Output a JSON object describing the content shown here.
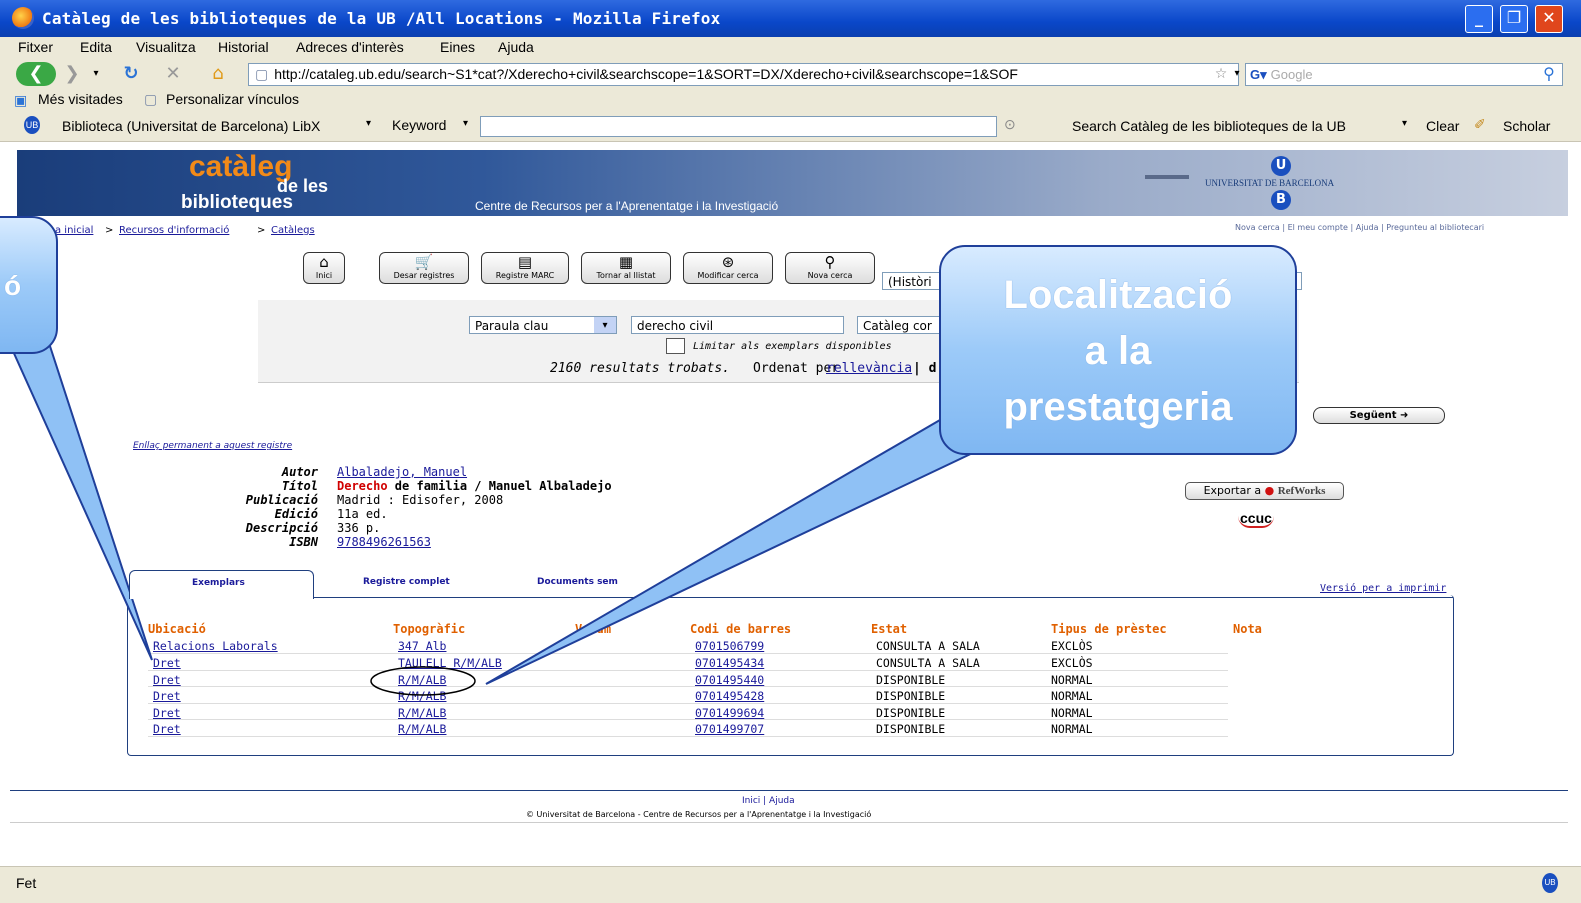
{
  "window": {
    "title": "Catàleg de les biblioteques de la UB /All Locations - Mozilla Firefox"
  },
  "menu": [
    "Fitxer",
    "Edita",
    "Visualitza",
    "Historial",
    "Adreces d'interès",
    "Eines",
    "Ajuda"
  ],
  "nav": {
    "url": "http://cataleg.ub.edu/search~S1*cat?/Xderecho+civil&searchscope=1&SORT=DX/Xderecho+civil&searchscope=1&SOF",
    "search_placeholder": "Google"
  },
  "bookmarks": [
    "Més visitades",
    "Personalizar vínculos"
  ],
  "libx": {
    "name": "Biblioteca (Universitat de Barcelona) LibX",
    "keyword": "Keyword",
    "search": "Search Catàleg de les biblioteques de la UB",
    "clear": "Clear",
    "scholar": "Scholar"
  },
  "banner": {
    "logo1": "catàleg",
    "logo2": "de les",
    "logo3": "biblioteques",
    "subtitle": "Centre de Recursos per a l'Aprenentatge i la Investigació",
    "university": "UNIVERSITAT DE BARCELONA"
  },
  "crumbs": {
    "home": "a inicial",
    "sep": ">",
    "res": "Recursos d'informació",
    "cat": "Catàlegs"
  },
  "toplinks": "Nova cerca | El meu compte | Ajuda | Pregunteu al bibliotecari",
  "tools": [
    "Inici",
    "Desar registres",
    "Registre MARC",
    "Tornar al llistat",
    "Modificar cerca",
    "Nova cerca"
  ],
  "tool_icons": [
    "home-icon",
    "cart-icon",
    "marc-icon",
    "list-icon",
    "modify-icon",
    "search-icon"
  ],
  "history_label": "(Històri",
  "search": {
    "type": "Paraula clau",
    "term": "derecho civil",
    "catalog": "Catàleg cor",
    "limit_label": "Limitar als exemplars disponibles",
    "results": "2160 resultats trobats.",
    "sorted": "Ordenat per",
    "relevance": "rellevància",
    "sep": "| d"
  },
  "next_label": "Següent",
  "permalink": "Enllaç permanent a aquest registre",
  "record": {
    "fields": [
      {
        "label": "Autor",
        "value": "Albaladejo, Manuel",
        "link": true
      },
      {
        "label": "Títol",
        "value_hl": "Derecho",
        "value": " de familia / Manuel Albaladejo"
      },
      {
        "label": "Publicació",
        "value": "Madrid : Edisofer, 2008"
      },
      {
        "label": "Edició",
        "value": "11a ed."
      },
      {
        "label": "Descripció",
        "value": "336 p."
      },
      {
        "label": "ISBN",
        "value": "9788496261563",
        "link": true
      }
    ]
  },
  "export": {
    "label": "Exportar a",
    "refworks": "RefWorks",
    "ccuc": "ccuc"
  },
  "tabs": [
    "Exemplars",
    "Registre complet",
    "Documents sem"
  ],
  "print_label": "Versió per a imprimir",
  "holdings": {
    "headers": [
      "Ubicació",
      "Topogràfic",
      "Volum",
      "Codi de barres",
      "Estat",
      "Tipus de prèstec",
      "Nota"
    ],
    "rows": [
      [
        "Relacions Laborals",
        "347 Alb",
        "",
        "0701506799",
        "CONSULTA A SALA",
        "EXCLÒS"
      ],
      [
        "Dret",
        "TAULELL R/M/ALB",
        "",
        "0701495434",
        "CONSULTA A SALA",
        "EXCLÒS"
      ],
      [
        "Dret",
        "R/M/ALB",
        "",
        "0701495440",
        "DISPONIBLE",
        "NORMAL"
      ],
      [
        "Dret",
        "R/M/ALB",
        "",
        "0701495428",
        "DISPONIBLE",
        "NORMAL"
      ],
      [
        "Dret",
        "R/M/ALB",
        "",
        "0701499694",
        "DISPONIBLE",
        "NORMAL"
      ],
      [
        "Dret",
        "R/M/ALB",
        "",
        "0701499707",
        "DISPONIBLE",
        "NORMAL"
      ]
    ]
  },
  "footer": {
    "links": "Inici | Ajuda",
    "copy": "© Universitat de Barcelona - Centre de Recursos per a l'Aprenentatge i la Investigació"
  },
  "callouts": {
    "left": "ó",
    "right_1": "Localització",
    "right_2": "a la",
    "right_3": "prestatgeria"
  },
  "status": "Fet"
}
